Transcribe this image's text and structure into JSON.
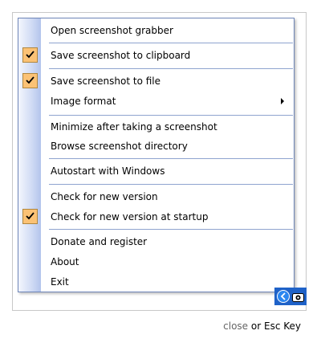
{
  "menu": {
    "items": [
      {
        "label": "Open screenshot grabber",
        "checked": false,
        "submenu": false
      },
      {
        "label": "Save screenshot to clipboard",
        "checked": true,
        "submenu": false
      },
      {
        "label": "Save screenshot to file",
        "checked": true,
        "submenu": false
      },
      {
        "label": "Image format",
        "checked": false,
        "submenu": true
      },
      {
        "label": "Minimize after taking a screenshot",
        "checked": false,
        "submenu": false
      },
      {
        "label": "Browse screenshot directory",
        "checked": false,
        "submenu": false
      },
      {
        "label": "Autostart with Windows",
        "checked": false,
        "submenu": false
      },
      {
        "label": "Check for new version",
        "checked": false,
        "submenu": false
      },
      {
        "label": "Check for new version at startup",
        "checked": true,
        "submenu": false
      },
      {
        "label": "Donate and register",
        "checked": false,
        "submenu": false
      },
      {
        "label": "About",
        "checked": false,
        "submenu": false
      },
      {
        "label": "Exit",
        "checked": false,
        "submenu": false
      }
    ]
  },
  "footer": {
    "close_label": "close",
    "or_text": " or ",
    "esc_label": "Esc Key"
  },
  "colors": {
    "check_bg": "#fbc275",
    "separator": "#8fa4cf",
    "menu_border": "#6f86b8",
    "tray": "#1f62c8"
  },
  "icons": {
    "checkmark": "checkmark-icon",
    "submenu": "submenu-arrow-icon",
    "tray_app": "tray-app-icon",
    "tray_camera": "camera-icon"
  }
}
